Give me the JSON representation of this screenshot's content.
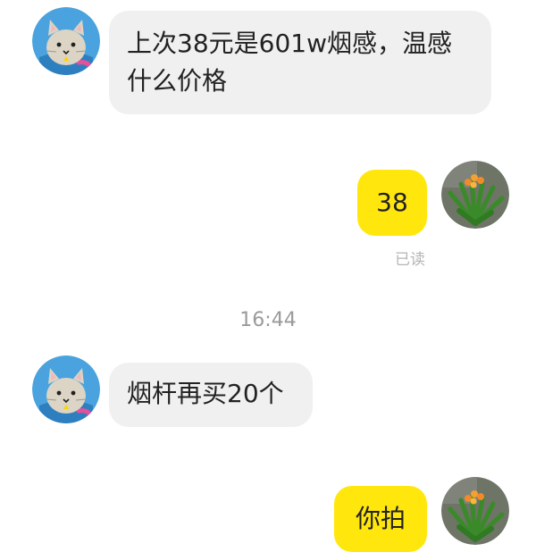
{
  "messages": [
    {
      "side": "in",
      "text": "上次38元是601w烟感，温感什么价格",
      "avatar": "cat-avatar"
    },
    {
      "side": "out",
      "text": "38",
      "status": "已读",
      "avatar": "plant-avatar"
    },
    {
      "side": "in",
      "text": "烟杆再买20个",
      "avatar": "cat-avatar"
    },
    {
      "side": "out",
      "text": "你拍",
      "avatar": "plant-avatar"
    }
  ],
  "timestamp": "16:44",
  "colors": {
    "incoming_bubble": "#f0f0f0",
    "outgoing_bubble": "#ffe70d",
    "read_status": "#b5b5b5",
    "timestamp": "#9a9a9a"
  }
}
